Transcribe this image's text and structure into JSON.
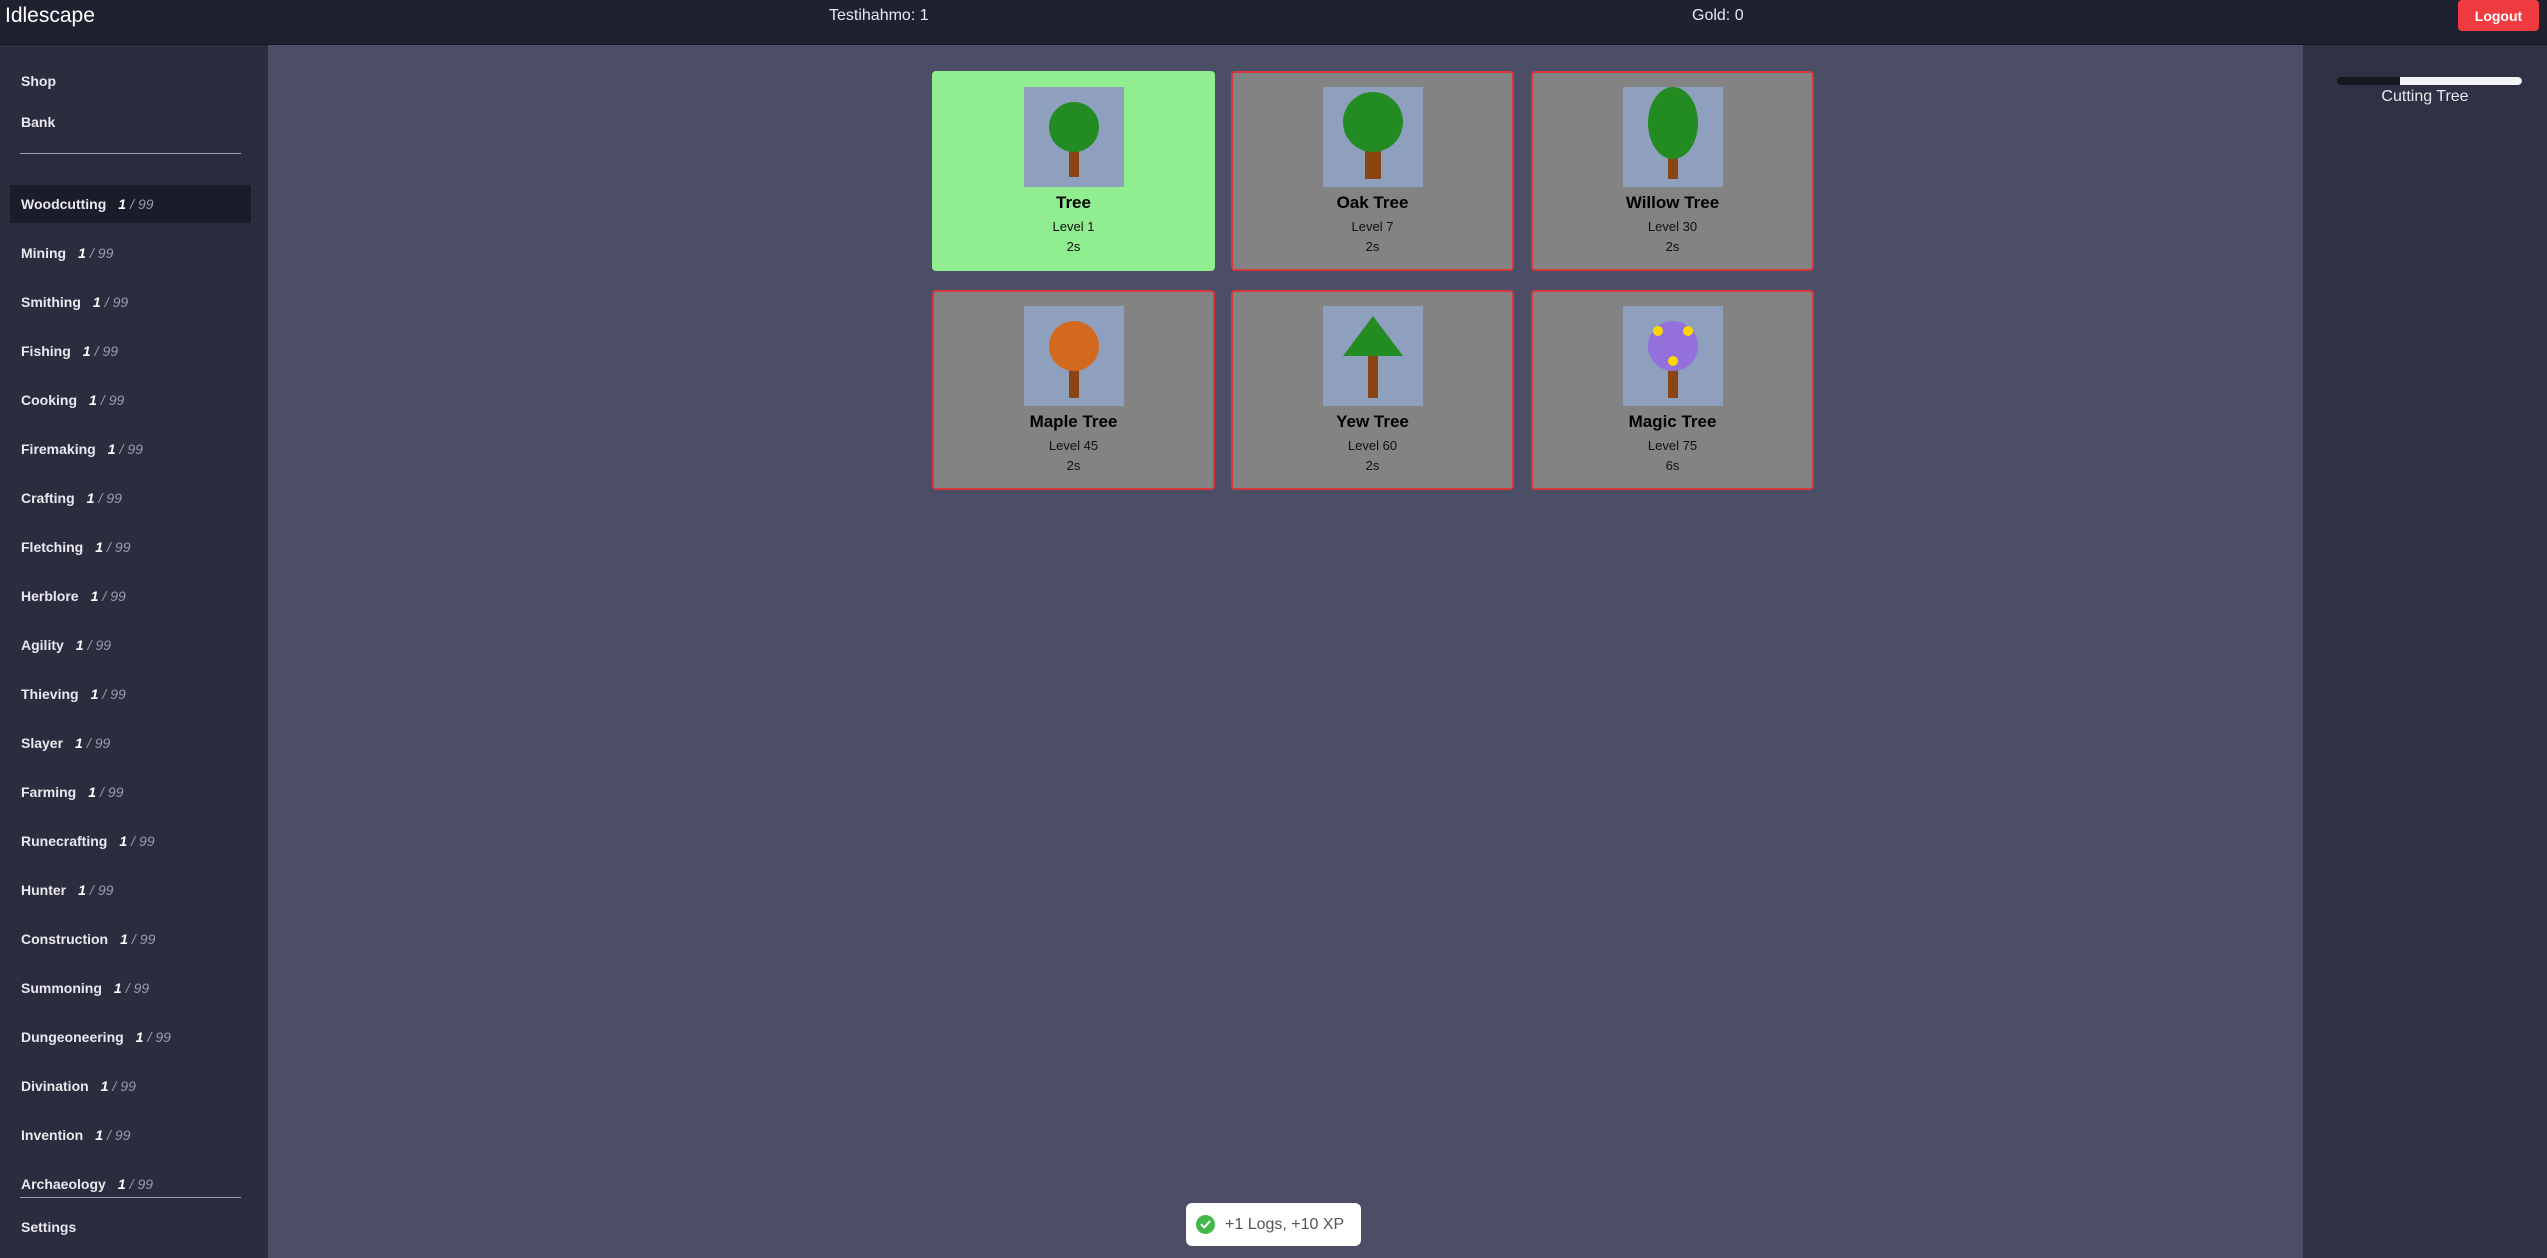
{
  "app": {
    "title": "Idlescape"
  },
  "header": {
    "character": "Testihahmo: 1",
    "gold": "Gold: 0",
    "logout_label": "Logout"
  },
  "nav": {
    "shop": "Shop",
    "bank": "Bank",
    "settings": "Settings"
  },
  "skills": [
    {
      "name": "Woodcutting",
      "level": "1",
      "max": "99",
      "active": true
    },
    {
      "name": "Mining",
      "level": "1",
      "max": "99"
    },
    {
      "name": "Smithing",
      "level": "1",
      "max": "99"
    },
    {
      "name": "Fishing",
      "level": "1",
      "max": "99"
    },
    {
      "name": "Cooking",
      "level": "1",
      "max": "99"
    },
    {
      "name": "Firemaking",
      "level": "1",
      "max": "99"
    },
    {
      "name": "Crafting",
      "level": "1",
      "max": "99"
    },
    {
      "name": "Fletching",
      "level": "1",
      "max": "99"
    },
    {
      "name": "Herblore",
      "level": "1",
      "max": "99"
    },
    {
      "name": "Agility",
      "level": "1",
      "max": "99"
    },
    {
      "name": "Thieving",
      "level": "1",
      "max": "99"
    },
    {
      "name": "Slayer",
      "level": "1",
      "max": "99"
    },
    {
      "name": "Farming",
      "level": "1",
      "max": "99"
    },
    {
      "name": "Runecrafting",
      "level": "1",
      "max": "99"
    },
    {
      "name": "Hunter",
      "level": "1",
      "max": "99"
    },
    {
      "name": "Construction",
      "level": "1",
      "max": "99"
    },
    {
      "name": "Summoning",
      "level": "1",
      "max": "99"
    },
    {
      "name": "Dungeoneering",
      "level": "1",
      "max": "99"
    },
    {
      "name": "Divination",
      "level": "1",
      "max": "99"
    },
    {
      "name": "Invention",
      "level": "1",
      "max": "99"
    },
    {
      "name": "Archaeology",
      "level": "1",
      "max": "99"
    }
  ],
  "action": {
    "label": "Cutting Tree",
    "progress": 0.66
  },
  "trees": [
    {
      "name": "Tree",
      "level": "Level 1",
      "time": "2s",
      "icon": "round-tree-icon",
      "selected": true
    },
    {
      "name": "Oak Tree",
      "level": "Level 7",
      "time": "2s",
      "icon": "oak-tree-icon"
    },
    {
      "name": "Willow Tree",
      "level": "Level 30",
      "time": "2s",
      "icon": "willow-tree-icon"
    },
    {
      "name": "Maple Tree",
      "level": "Level 45",
      "time": "2s",
      "icon": "maple-tree-icon"
    },
    {
      "name": "Yew Tree",
      "level": "Level 60",
      "time": "2s",
      "icon": "yew-tree-icon"
    },
    {
      "name": "Magic Tree",
      "level": "Level 75",
      "time": "6s",
      "icon": "magic-tree-icon"
    }
  ],
  "toast": {
    "message": "+1 Logs, +10 XP",
    "icon": "check-circle-icon"
  },
  "colors": {
    "selected_card": "#90ee90",
    "locked_card_border": "#d6383c",
    "logout": "#ef3b3f",
    "trunk": "#8b4513",
    "leaf_green": "#228b22",
    "maple_orange": "#d2691e",
    "magic_purple": "#9370db",
    "magic_dot": "#ffd700"
  }
}
